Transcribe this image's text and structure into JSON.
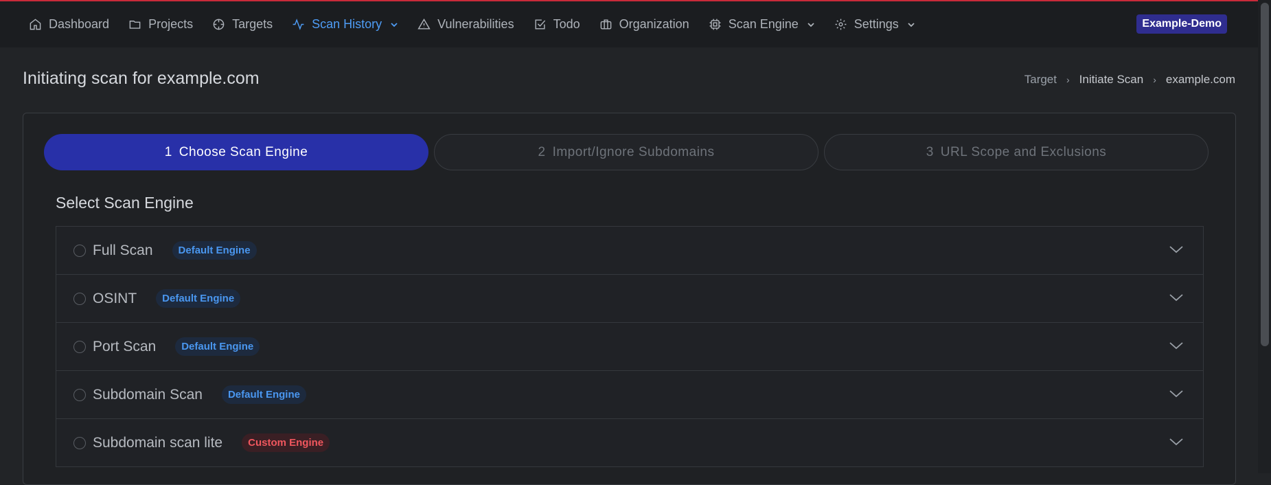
{
  "nav": {
    "items": [
      {
        "label": "Dashboard",
        "icon": "home-icon",
        "active": false,
        "dropdown": false
      },
      {
        "label": "Projects",
        "icon": "folder-icon",
        "active": false,
        "dropdown": false
      },
      {
        "label": "Targets",
        "icon": "crosshair-icon",
        "active": false,
        "dropdown": false
      },
      {
        "label": "Scan History",
        "icon": "activity-icon",
        "active": true,
        "dropdown": true
      },
      {
        "label": "Vulnerabilities",
        "icon": "warning-icon",
        "active": false,
        "dropdown": false
      },
      {
        "label": "Todo",
        "icon": "checkbox-icon",
        "active": false,
        "dropdown": false
      },
      {
        "label": "Organization",
        "icon": "briefcase-icon",
        "active": false,
        "dropdown": false
      },
      {
        "label": "Scan Engine",
        "icon": "cpu-icon",
        "active": false,
        "dropdown": true
      },
      {
        "label": "Settings",
        "icon": "gear-icon",
        "active": false,
        "dropdown": true
      }
    ],
    "org_badge": "Example-Demo"
  },
  "header": {
    "title": "Initiating scan for example.com",
    "breadcrumb": [
      "Target",
      "Initiate Scan",
      "example.com"
    ]
  },
  "wizard": {
    "steps": [
      {
        "num": "1",
        "label": "Choose Scan Engine",
        "active": true
      },
      {
        "num": "2",
        "label": "Import/Ignore Subdomains",
        "active": false
      },
      {
        "num": "3",
        "label": "URL Scope and Exclusions",
        "active": false
      }
    ]
  },
  "engines": {
    "section_title": "Select Scan Engine",
    "items": [
      {
        "name": "Full Scan",
        "badge": "Default Engine",
        "type": "default"
      },
      {
        "name": "OSINT",
        "badge": "Default Engine",
        "type": "default"
      },
      {
        "name": "Port Scan",
        "badge": "Default Engine",
        "type": "default"
      },
      {
        "name": "Subdomain Scan",
        "badge": "Default Engine",
        "type": "default"
      },
      {
        "name": "Subdomain scan lite",
        "badge": "Custom Engine",
        "type": "custom"
      }
    ]
  },
  "colors": {
    "accent": "#2830a8",
    "active_nav": "#4e9cf5",
    "top_line": "#c92a3a",
    "org_badge": "#2f2d8f",
    "default_badge_text": "#4a97f0",
    "custom_badge_text": "#f0575e"
  }
}
